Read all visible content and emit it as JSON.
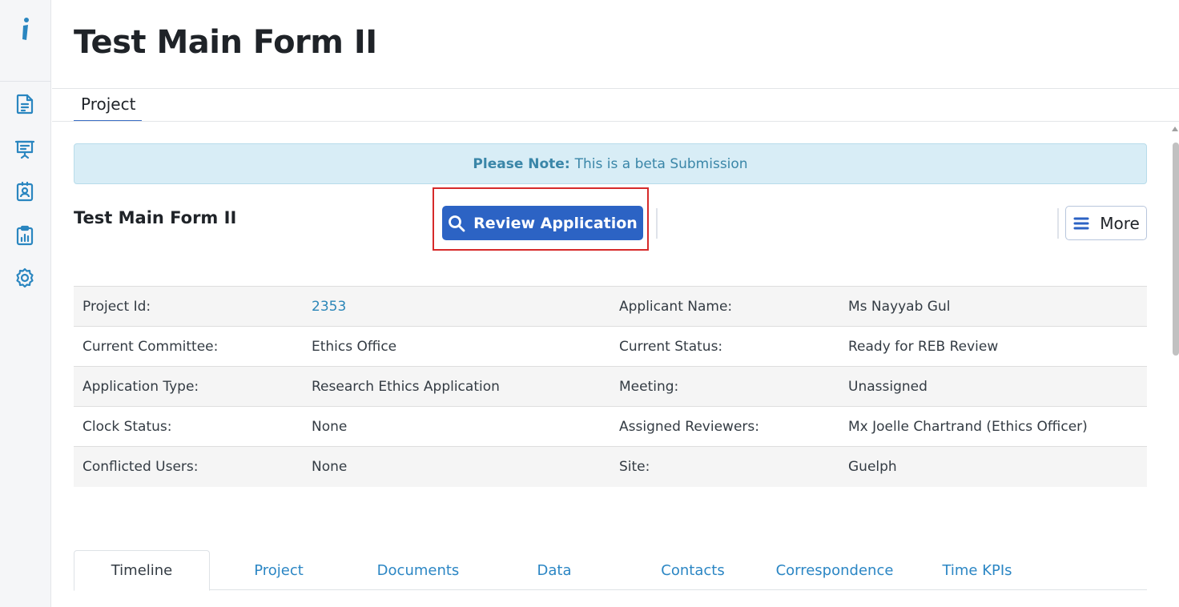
{
  "sidebar": {
    "logo": "i",
    "icons": [
      "document-icon",
      "presentation-icon",
      "contact-badge-icon",
      "clipboard-chart-icon",
      "settings-gear-icon"
    ]
  },
  "header": {
    "title": "Test Main Form II"
  },
  "top_tab": {
    "label": "Project"
  },
  "alert": {
    "bold": "Please Note:",
    "text": "This is a beta Submission"
  },
  "section": {
    "title": "Test Main Form II"
  },
  "actions": {
    "review_label": "Review Application",
    "more_label": "More"
  },
  "info": [
    {
      "l1": "Project Id:",
      "v1": "2353",
      "l2": "Applicant Name:",
      "v2": "Ms Nayyab Gul"
    },
    {
      "l1": "Current Committee:",
      "v1": "Ethics Office",
      "l2": "Current Status:",
      "v2": "Ready for REB Review"
    },
    {
      "l1": "Application Type:",
      "v1": "Research Ethics Application",
      "l2": "Meeting:",
      "v2": "Unassigned"
    },
    {
      "l1": "Clock Status:",
      "v1": "None",
      "l2": "Assigned Reviewers:",
      "v2": "Mx Joelle Chartrand (Ethics Officer)"
    },
    {
      "l1": "Conflicted Users:",
      "v1": "None",
      "l2": "Site:",
      "v2": "Guelph"
    }
  ],
  "tabs": [
    "Timeline",
    "Project",
    "Documents",
    "Data",
    "Contacts",
    "Correspondence",
    "Time KPIs"
  ],
  "colors": {
    "primary": "#2c63c4",
    "link": "#2b86b8",
    "alert_bg": "#d8edf6",
    "highlight": "#d62a2a",
    "sidebar_icon": "#2a86c0"
  }
}
